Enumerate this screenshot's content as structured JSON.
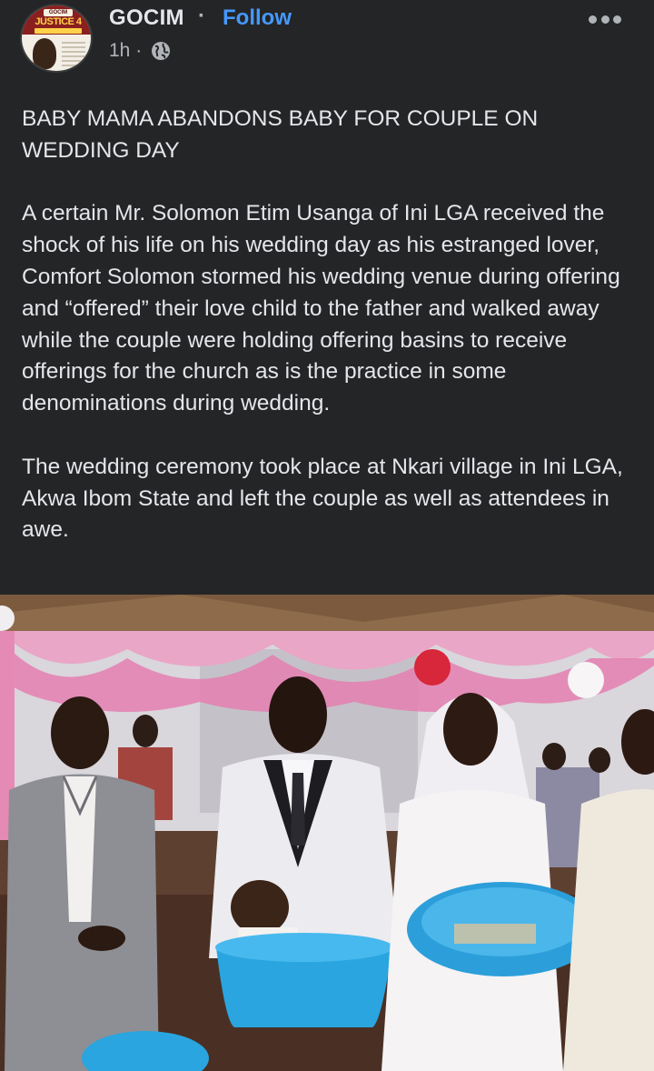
{
  "post": {
    "page_name": "GOCIM",
    "separator": "·",
    "follow_label": "Follow",
    "time": "1h ·",
    "privacy_icon": "globe-icon",
    "more_icon": "more-options-icon",
    "avatar": {
      "logo_top": "GOCIM",
      "logo_text": "JUSTICE 4"
    },
    "paragraphs": [
      "BABY MAMA ABANDONS BABY FOR COUPLE ON WEDDING DAY",
      "A certain Mr. Solomon Etim Usanga of Ini LGA received the shock of his life on his wedding day as his estranged lover, Comfort Solomon stormed his wedding venue during offering and “offered” their love child to the father and walked away while the couple were holding offering basins to receive offerings for the church as is the practice in some denominations during wedding.",
      "The wedding ceremony took place at Nkari village in Ini LGA, Akwa Ibom State and left the couple as well as attendees in awe."
    ]
  },
  "colors": {
    "background": "#242526",
    "text": "#e4e6eb",
    "secondary_text": "#b0b3b8",
    "follow_link": "#4599ff"
  }
}
